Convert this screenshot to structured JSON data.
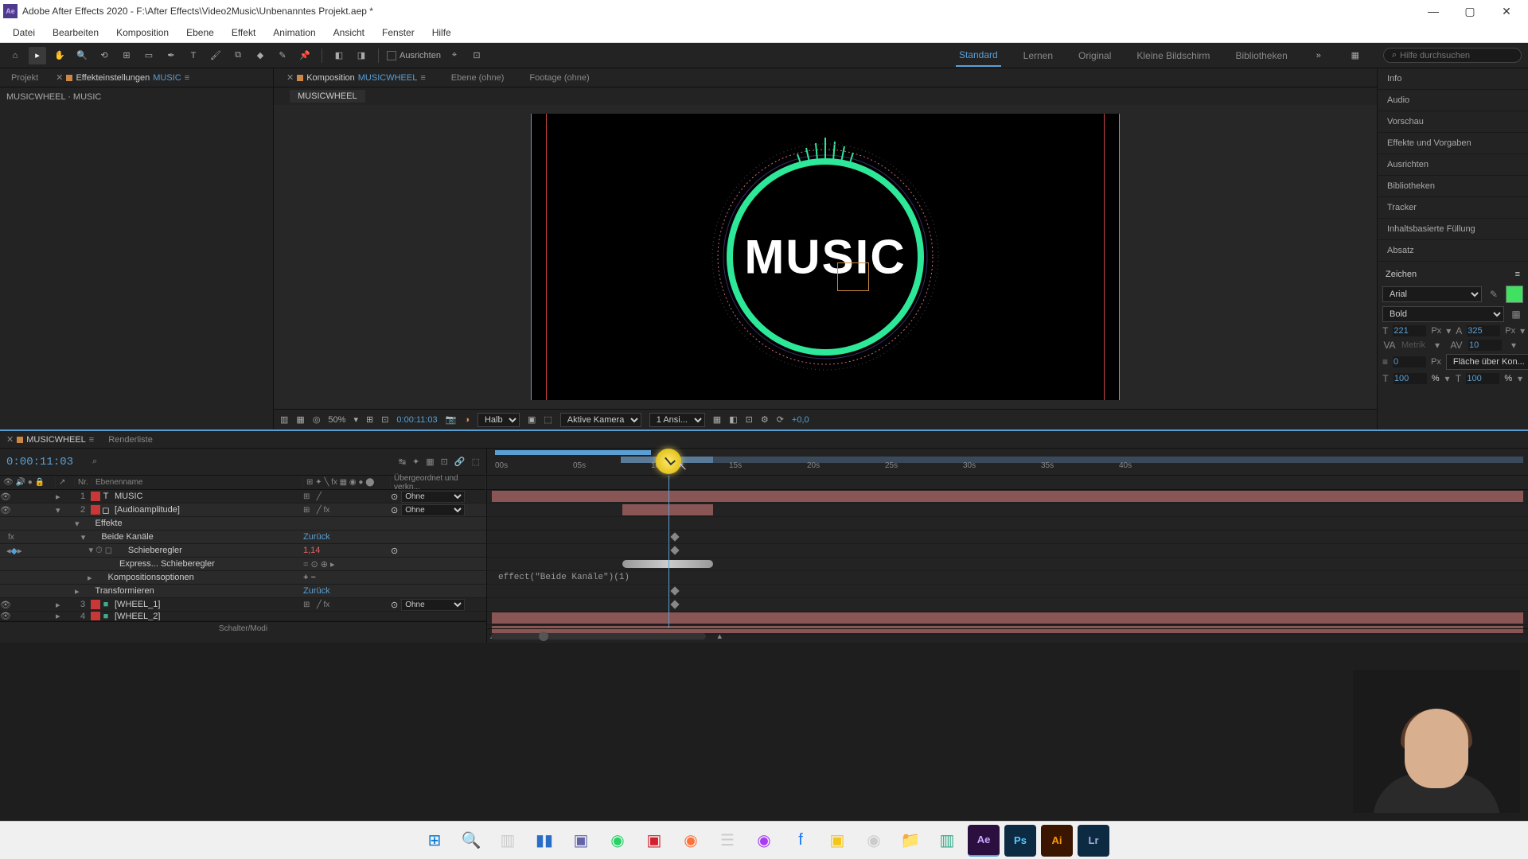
{
  "app": {
    "icon_label": "Ae",
    "title": "Adobe After Effects 2020 - F:\\After Effects\\Video2Music\\Unbenanntes Projekt.aep *"
  },
  "menu": [
    "Datei",
    "Bearbeiten",
    "Komposition",
    "Ebene",
    "Effekt",
    "Animation",
    "Ansicht",
    "Fenster",
    "Hilfe"
  ],
  "toolbar": {
    "align_label": "Ausrichten",
    "workspaces": [
      {
        "label": "Standard",
        "active": true
      },
      {
        "label": "Lernen",
        "active": false
      },
      {
        "label": "Original",
        "active": false
      },
      {
        "label": "Kleine Bildschirm",
        "active": false
      },
      {
        "label": "Bibliotheken",
        "active": false
      }
    ],
    "search_placeholder": "Hilfe durchsuchen"
  },
  "left": {
    "tabs": {
      "project": "Projekt",
      "effect_controls_prefix": "Effekteinstellungen",
      "effect_controls_target": "MUSIC"
    },
    "breadcrumb": "MUSICWHEEL · MUSIC"
  },
  "center": {
    "tabs": {
      "composition_prefix": "Komposition",
      "composition_name": "MUSICWHEEL",
      "layer_none": "Ebene (ohne)",
      "footage_none": "Footage (ohne)"
    },
    "sub_tab": "MUSICWHEEL",
    "preview_text": "MUSIC",
    "controls": {
      "zoom": "50%",
      "timecode": "0:00:11:03",
      "resolution": "Halb",
      "camera": "Aktive Kamera",
      "views": "1 Ansi...",
      "exposure": "+0,0"
    }
  },
  "right": {
    "panels": [
      "Info",
      "Audio",
      "Vorschau",
      "Effekte und Vorgaben",
      "Ausrichten",
      "Bibliotheken",
      "Tracker",
      "Inhaltsbasierte Füllung",
      "Absatz"
    ],
    "character": {
      "title": "Zeichen",
      "font_family": "Arial",
      "font_style": "Bold",
      "size": "221",
      "size_unit": "Px",
      "leading": "325",
      "leading_unit": "Px",
      "kerning": "Metrik",
      "tracking": "10",
      "stroke": "0",
      "stroke_unit": "Px",
      "stroke_style": "Fläche über Kon...",
      "vscale": "100",
      "hscale": "100",
      "pct": "%"
    }
  },
  "timeline": {
    "tabs": {
      "active": "MUSICWHEEL",
      "render": "Renderliste"
    },
    "timecode": "0:00:11:03",
    "columns": {
      "nr": "Nr.",
      "name": "Ebenenname",
      "parent": "Übergeordnet und verkn..."
    },
    "ticks": [
      "00s",
      "05s",
      "10s",
      "15s",
      "20s",
      "25s",
      "30s",
      "35s",
      "40s"
    ],
    "layers": [
      {
        "num": "1",
        "color": "#c83838",
        "type": "T",
        "name": "MUSIC",
        "parent": "Ohne"
      },
      {
        "num": "2",
        "color": "#c83838",
        "type": "□",
        "name": "[Audioamplitude]",
        "parent": "Ohne"
      }
    ],
    "sub": {
      "effects": "Effekte",
      "both_channels": "Beide Kanäle",
      "reset": "Zurück",
      "slider": "Schieberegler",
      "slider_value": "1,14",
      "express": "Express... Schieberegler",
      "comp_options": "Kompositionsoptionen",
      "transform": "Transformieren",
      "transform_reset": "Zurück"
    },
    "layers2": [
      {
        "num": "3",
        "color": "#c83838",
        "type": "■",
        "name": "[WHEEL_1]",
        "parent": "Ohne"
      },
      {
        "num": "4",
        "color": "#c83838",
        "type": "■",
        "name": "[WHEEL_2]",
        "parent": ""
      }
    ],
    "expression": "effect(\"Beide Kanäle\")(1)",
    "footer": "Schalter/Modi"
  },
  "taskbar": {
    "items": [
      "windows",
      "search",
      "task-view",
      "explorer",
      "teams",
      "whatsapp",
      "avira",
      "firefox",
      "steam",
      "messenger",
      "facebook",
      "notes",
      "obs",
      "folder",
      "notepad",
      "ae",
      "ps",
      "ai",
      "lr"
    ]
  }
}
